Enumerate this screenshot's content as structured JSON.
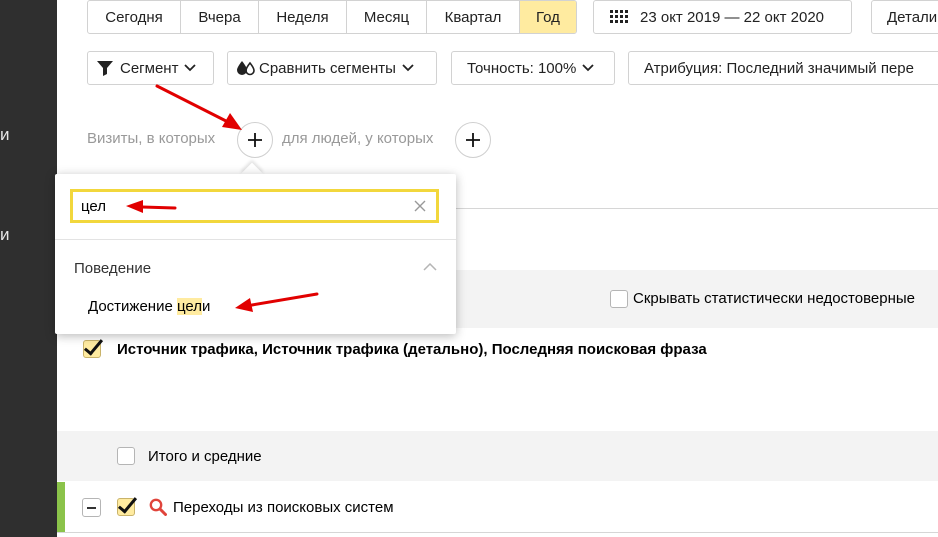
{
  "left_nav": {
    "fragments": [
      "и",
      "и"
    ]
  },
  "period": {
    "buttons": [
      "Сегодня",
      "Вчера",
      "Неделя",
      "Месяц",
      "Квартал",
      "Год"
    ],
    "active": "Год",
    "date_range": "23 окт 2019 — 22 окт 2020",
    "detail_label": "Детали"
  },
  "toolbar": {
    "segment_label": "Сегмент",
    "compare_label": "Сравнить сегменты",
    "accuracy_label": "Точность: 100%",
    "attribution_label": "Атрибуция: Последний значимый пере"
  },
  "conditions": {
    "visits_label": "Визиты, в которых",
    "people_label": "для людей, у которых"
  },
  "search_popup": {
    "query": "цел",
    "category": "Поведение",
    "result_prefix": "Достижение ",
    "result_highlight": "цел",
    "result_suffix": "и"
  },
  "options": {
    "hide_unreliable_label": "Скрывать статистически недостоверные"
  },
  "grouping": {
    "label": "Источник трафика, Источник трафика (детально), Последняя поисковая фраза",
    "checked": true
  },
  "table": {
    "totals_label": "Итого и средние",
    "rows": [
      {
        "label": "Переходы из поисковых систем",
        "checked": true
      }
    ]
  },
  "colors": {
    "active_period": "#ffeba0",
    "input_border": "#f2d73c",
    "highlight": "#ffeba0",
    "arrow": "#e10000",
    "nav_bg": "#2f2f2f",
    "row_indicator": "#8bc34a"
  }
}
